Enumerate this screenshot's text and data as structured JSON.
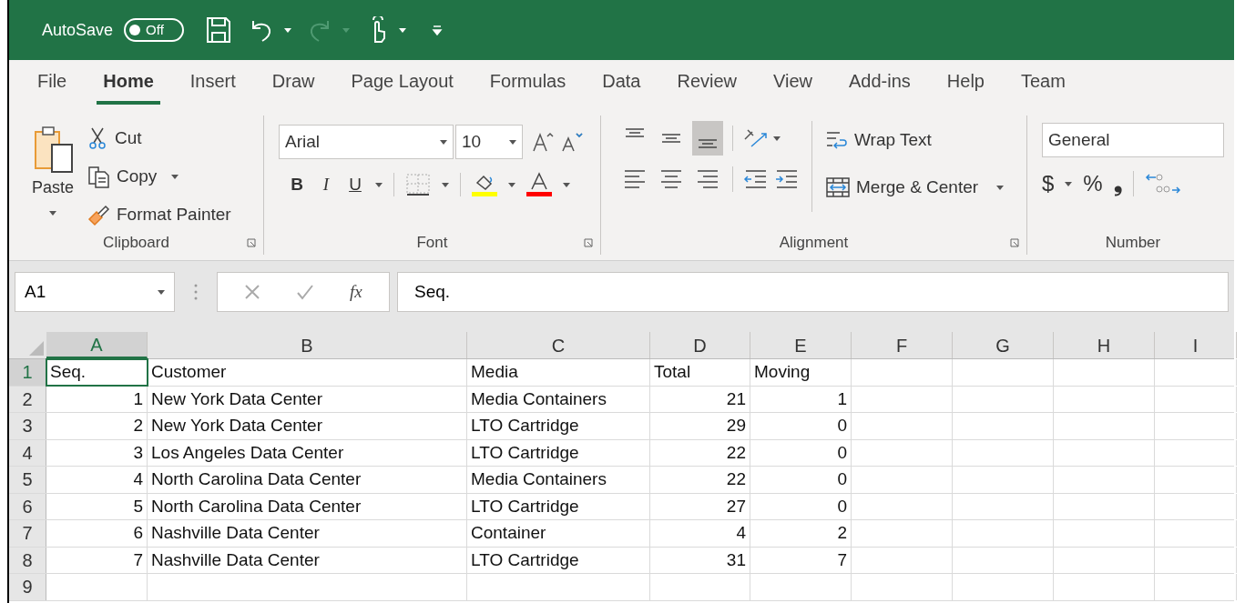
{
  "title_bar": {
    "autosave_label": "AutoSave",
    "autosave_toggle": {
      "label": "Off",
      "on": false
    }
  },
  "ribbon_tabs": [
    {
      "label": "File",
      "selected": false
    },
    {
      "label": "Home",
      "selected": true
    },
    {
      "label": "Insert",
      "selected": false
    },
    {
      "label": "Draw",
      "selected": false
    },
    {
      "label": "Page Layout",
      "selected": false
    },
    {
      "label": "Formulas",
      "selected": false
    },
    {
      "label": "Data",
      "selected": false
    },
    {
      "label": "Review",
      "selected": false
    },
    {
      "label": "View",
      "selected": false
    },
    {
      "label": "Add-ins",
      "selected": false
    },
    {
      "label": "Help",
      "selected": false
    },
    {
      "label": "Team",
      "selected": false
    }
  ],
  "ribbon": {
    "clipboard": {
      "title": "Clipboard",
      "paste": "Paste",
      "cut": "Cut",
      "copy": "Copy",
      "format_painter": "Format Painter"
    },
    "font": {
      "title": "Font",
      "font_name": "Arial",
      "font_size": "10",
      "bold": "B",
      "italic": "I",
      "underline": "U"
    },
    "alignment": {
      "title": "Alignment",
      "wrap_text": "Wrap Text",
      "merge_center": "Merge & Center",
      "vertical_align": [
        {
          "kind": "top",
          "selected": false
        },
        {
          "kind": "middle",
          "selected": false
        },
        {
          "kind": "bottom",
          "selected": true
        }
      ]
    },
    "number": {
      "title": "Number",
      "format": "General",
      "currency": "$",
      "percent": "%",
      "comma": "❟"
    }
  },
  "formula_bar": {
    "name_box": "A1",
    "fx": "fx",
    "formula": "Seq."
  },
  "sheet": {
    "columns": [
      {
        "label": "A",
        "selected": true
      },
      {
        "label": "B",
        "selected": false
      },
      {
        "label": "C",
        "selected": false
      },
      {
        "label": "D",
        "selected": false
      },
      {
        "label": "E",
        "selected": false
      },
      {
        "label": "F",
        "selected": false
      },
      {
        "label": "G",
        "selected": false
      },
      {
        "label": "H",
        "selected": false
      },
      {
        "label": "I",
        "selected": false
      }
    ],
    "rows": [
      {
        "label": "1",
        "selected": true,
        "cells": [
          {
            "text": "Seq.",
            "kind": "text",
            "selected": true
          },
          {
            "text": "Customer",
            "kind": "text",
            "selected": false
          },
          {
            "text": "Media",
            "kind": "text",
            "selected": false
          },
          {
            "text": "Total",
            "kind": "text",
            "selected": false
          },
          {
            "text": "Moving",
            "kind": "text",
            "selected": false
          }
        ]
      },
      {
        "label": "2",
        "selected": false,
        "cells": [
          {
            "text": "1",
            "kind": "number",
            "selected": false
          },
          {
            "text": "New York Data Center",
            "kind": "text",
            "selected": false
          },
          {
            "text": "Media Containers",
            "kind": "text",
            "selected": false
          },
          {
            "text": "21",
            "kind": "number",
            "selected": false
          },
          {
            "text": "1",
            "kind": "number",
            "selected": false
          }
        ]
      },
      {
        "label": "3",
        "selected": false,
        "cells": [
          {
            "text": "2",
            "kind": "number",
            "selected": false
          },
          {
            "text": "New York Data Center",
            "kind": "text",
            "selected": false
          },
          {
            "text": "LTO Cartridge",
            "kind": "text",
            "selected": false
          },
          {
            "text": "29",
            "kind": "number",
            "selected": false
          },
          {
            "text": "0",
            "kind": "number",
            "selected": false
          }
        ]
      },
      {
        "label": "4",
        "selected": false,
        "cells": [
          {
            "text": "3",
            "kind": "number",
            "selected": false
          },
          {
            "text": "Los Angeles Data Center",
            "kind": "text",
            "selected": false
          },
          {
            "text": "LTO Cartridge",
            "kind": "text",
            "selected": false
          },
          {
            "text": "22",
            "kind": "number",
            "selected": false
          },
          {
            "text": "0",
            "kind": "number",
            "selected": false
          }
        ]
      },
      {
        "label": "5",
        "selected": false,
        "cells": [
          {
            "text": "4",
            "kind": "number",
            "selected": false
          },
          {
            "text": "North Carolina Data Center",
            "kind": "text",
            "selected": false
          },
          {
            "text": "Media Containers",
            "kind": "text",
            "selected": false
          },
          {
            "text": "22",
            "kind": "number",
            "selected": false
          },
          {
            "text": "0",
            "kind": "number",
            "selected": false
          }
        ]
      },
      {
        "label": "6",
        "selected": false,
        "cells": [
          {
            "text": "5",
            "kind": "number",
            "selected": false
          },
          {
            "text": "North Carolina Data Center",
            "kind": "text",
            "selected": false
          },
          {
            "text": "LTO Cartridge",
            "kind": "text",
            "selected": false
          },
          {
            "text": "27",
            "kind": "number",
            "selected": false
          },
          {
            "text": "0",
            "kind": "number",
            "selected": false
          }
        ]
      },
      {
        "label": "7",
        "selected": false,
        "cells": [
          {
            "text": "6",
            "kind": "number",
            "selected": false
          },
          {
            "text": "Nashville Data Center",
            "kind": "text",
            "selected": false
          },
          {
            "text": "Container",
            "kind": "text",
            "selected": false
          },
          {
            "text": "4",
            "kind": "number",
            "selected": false
          },
          {
            "text": "2",
            "kind": "number",
            "selected": false
          }
        ]
      },
      {
        "label": "8",
        "selected": false,
        "cells": [
          {
            "text": "7",
            "kind": "number",
            "selected": false
          },
          {
            "text": "Nashville Data Center",
            "kind": "text",
            "selected": false
          },
          {
            "text": "LTO Cartridge",
            "kind": "text",
            "selected": false
          },
          {
            "text": "31",
            "kind": "number",
            "selected": false
          },
          {
            "text": "7",
            "kind": "number",
            "selected": false
          }
        ]
      },
      {
        "label": "9",
        "selected": false
      }
    ]
  }
}
